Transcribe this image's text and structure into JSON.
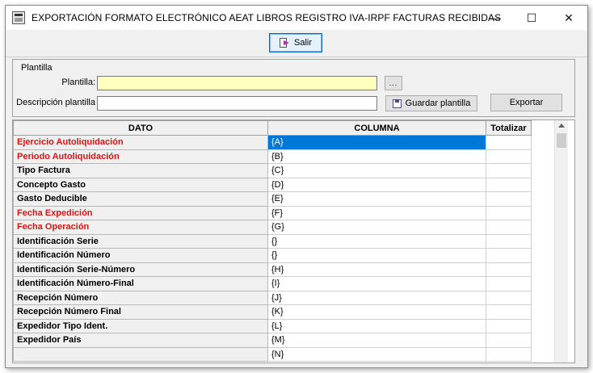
{
  "window": {
    "title": "EXPORTACIÓN FORMATO ELECTRÓNICO AEAT LIBROS REGISTRO IVA-IRPF FACTURAS RECIBIDAS",
    "minimize_glyph": "—",
    "maximize_glyph": "☐",
    "close_glyph": "✕"
  },
  "toolbar": {
    "exit_label": "Salir"
  },
  "template_panel": {
    "group_label": "Plantilla",
    "template_label": "Plantilla:",
    "template_value": "",
    "browse_label": "...",
    "description_label": "Descripción plantilla",
    "description_value": "",
    "save_label": "Guardar plantilla",
    "export_label": "Exportar"
  },
  "grid": {
    "headers": {
      "dato": "DATO",
      "columna": "COLUMNA",
      "totalizar": "Totalizar"
    },
    "rows": [
      {
        "dato": "Ejercicio Autoliquidación",
        "columna": "{A}",
        "required": true,
        "selected": true
      },
      {
        "dato": "Periodo Autoliquidación",
        "columna": "{B}",
        "required": true
      },
      {
        "dato": "Tipo Factura",
        "columna": "{C}"
      },
      {
        "dato": "Concepto Gasto",
        "columna": "{D}"
      },
      {
        "dato": "Gasto Deducible",
        "columna": "{E}"
      },
      {
        "dato": "Fecha Expedición",
        "columna": "{F}",
        "required": true
      },
      {
        "dato": "Fecha Operación",
        "columna": "{G}",
        "required": true
      },
      {
        "dato": "Identificación Serie",
        "columna": "{}"
      },
      {
        "dato": "Identificación Número",
        "columna": "{}"
      },
      {
        "dato": "Identificación Serie-Número",
        "columna": "{H}"
      },
      {
        "dato": "Identificación Número-Final",
        "columna": "{I}"
      },
      {
        "dato": "Recepción Número",
        "columna": "{J}"
      },
      {
        "dato": "Recepción Número Final",
        "columna": "{K}"
      },
      {
        "dato": "Expedidor Tipo Ident.",
        "columna": "{L}"
      },
      {
        "dato": "Expedidor País",
        "columna": "{M}"
      },
      {
        "dato": "",
        "columna": "{N}"
      }
    ]
  },
  "colors": {
    "required_text": "#e01010",
    "selection": "#0078d7",
    "template_field": "#ffffc0"
  }
}
